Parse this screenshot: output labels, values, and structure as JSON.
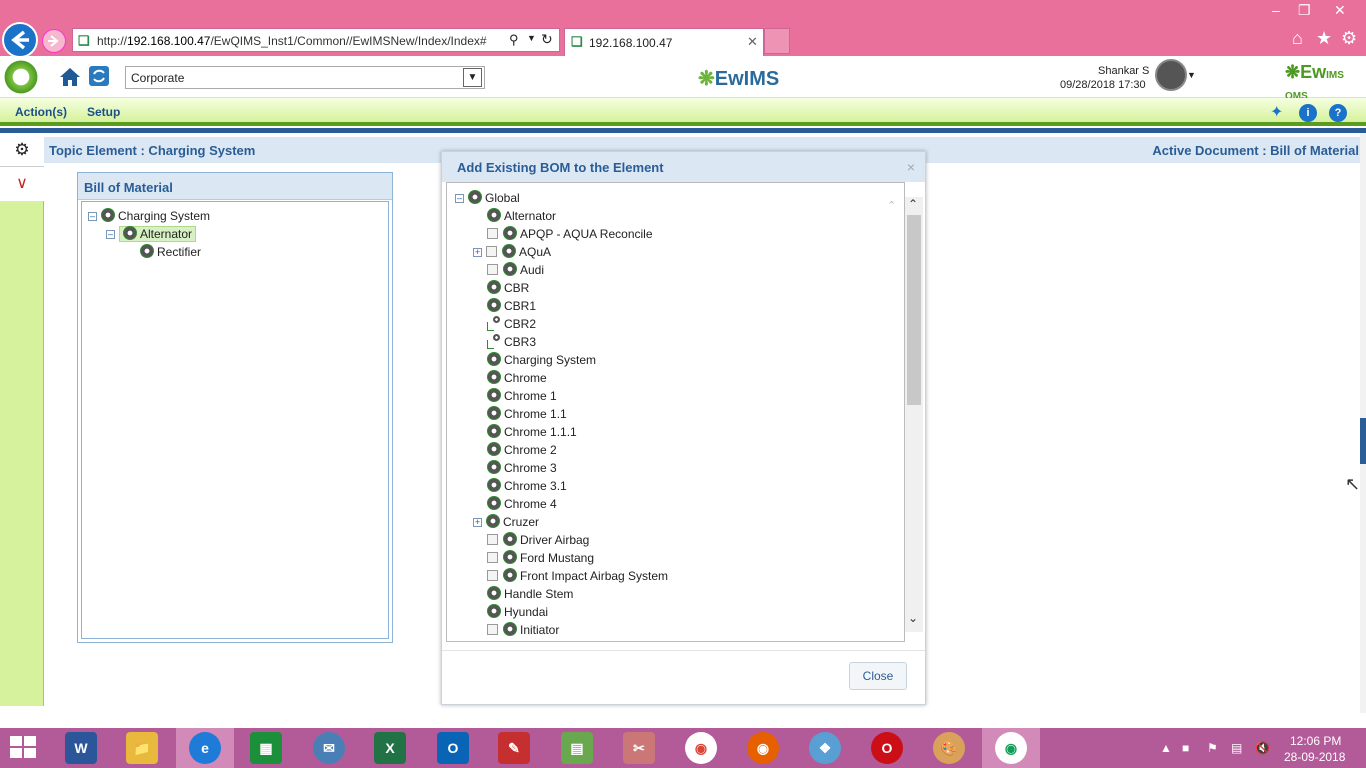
{
  "browser": {
    "url_prefix": "http://",
    "url_host": "192.168.100.47",
    "url_path": "/EwQIMS_Inst1/Common//EwIMSNew/Index/Index#",
    "tab_title": "192.168.100.47"
  },
  "header": {
    "site_select": "Corporate",
    "center_logo": "EwIMS",
    "user_name": "Shankar S",
    "user_datetime": "09/28/2018 17:30",
    "right_logo_prefix": "Ew",
    "right_logo_suffix": "IMS QMS"
  },
  "menu": {
    "actions": "Action(s)",
    "setup": "Setup"
  },
  "topic": {
    "title": "Topic Element : Charging System",
    "active_document": "Active Document : Bill of Material"
  },
  "bom_panel": {
    "title": "Bill of Material",
    "nodes": [
      "Charging System",
      "Alternator",
      "Rectifier"
    ]
  },
  "modal": {
    "title": "Add Existing BOM to the Element",
    "close_x": "×",
    "close_button": "Close",
    "root": "Global",
    "items": [
      {
        "label": "Alternator"
      },
      {
        "label": "APQP - AQUA Reconcile"
      },
      {
        "label": "AQuA"
      },
      {
        "label": "Audi"
      },
      {
        "label": "CBR"
      },
      {
        "label": "CBR1"
      },
      {
        "label": "CBR2"
      },
      {
        "label": "CBR3"
      },
      {
        "label": "Charging System"
      },
      {
        "label": "Chrome"
      },
      {
        "label": "Chrome 1"
      },
      {
        "label": "Chrome 1.1"
      },
      {
        "label": "Chrome 1.1.1"
      },
      {
        "label": "Chrome 2"
      },
      {
        "label": "Chrome 3"
      },
      {
        "label": "Chrome 3.1"
      },
      {
        "label": "Chrome 4"
      },
      {
        "label": "Cruzer"
      },
      {
        "label": "Driver Airbag"
      },
      {
        "label": "Ford Mustang"
      },
      {
        "label": "Front Impact Airbag System"
      },
      {
        "label": "Handle Stem"
      },
      {
        "label": "Hyundai"
      },
      {
        "label": "Initiator"
      }
    ]
  },
  "taskbar": {
    "time": "12:06 PM",
    "date": "28-09-2018"
  },
  "colors": {
    "browser_chrome": "#e8709a",
    "menu_green": "#d6f29b",
    "header_blue": "#2a5d96",
    "taskbar": "#b35a99"
  }
}
